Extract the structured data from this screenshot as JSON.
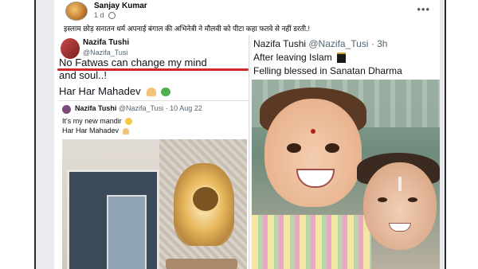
{
  "post": {
    "author": "Sanjay Kumar",
    "time": "1 d",
    "more_icon": "more-horizontal-icon",
    "caption": "इस्लाम छोड़ सनातन धर्म अपनाई बंगाल की अभिनेत्री ने मौलवी को पीटा कहा फतवे से नहीं डरती.!"
  },
  "left_tweet": {
    "name": "Nazifa Tushi",
    "handle": "@Nazifa_Tusi",
    "line1": "No Fatwas can change my mind",
    "line2": "and soul..!",
    "line3": "Har Har Mahadev",
    "underline_color": "#d4272b"
  },
  "inner_tweet": {
    "name": "Nazifa Tushi",
    "handle_date": "@Nazifa_Tusi · 10 Aug 22",
    "line1": "It's my new mandir",
    "line2": "Har Har Mahadev"
  },
  "right_tweet": {
    "name": "Nazifa Tushi",
    "handle_time": "@Nazifa_Tusi · 3h",
    "line1": "After leaving Islam",
    "line2": "Felling blessed in Sanatan Dharma"
  }
}
